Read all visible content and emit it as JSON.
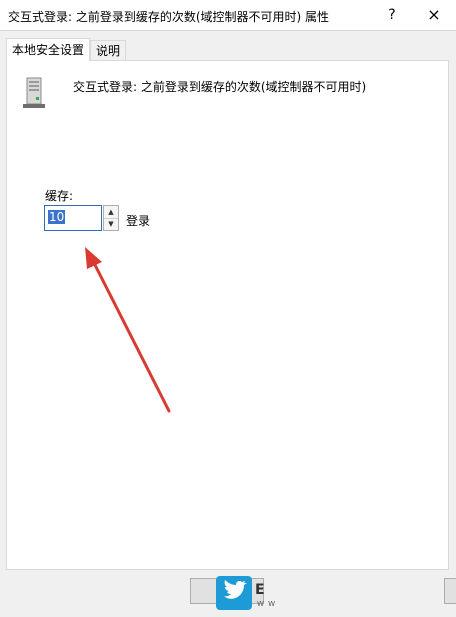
{
  "window": {
    "title": "交互式登录: 之前登录到缓存的次数(域控制器不可用时) 属性",
    "help_glyph": "?",
    "close_glyph": "×"
  },
  "tabs": [
    {
      "label": "本地安全设置",
      "active": true
    },
    {
      "label": "说明",
      "active": false
    }
  ],
  "policy": {
    "icon": "server-icon",
    "heading": "交互式登录: 之前登录到缓存的次数(域控制器不可用时)"
  },
  "cache": {
    "label": "缓存:",
    "value": "10",
    "unit": "登录"
  },
  "annotation": {
    "arrow_color": "#d93a32"
  },
  "footer": {
    "ok_label": "",
    "right_label": "",
    "watermark_mark": "E",
    "watermark_sub": "W W"
  },
  "colors": {
    "accent": "#3a73c9",
    "watermark_blue": "#1d9bd7"
  }
}
